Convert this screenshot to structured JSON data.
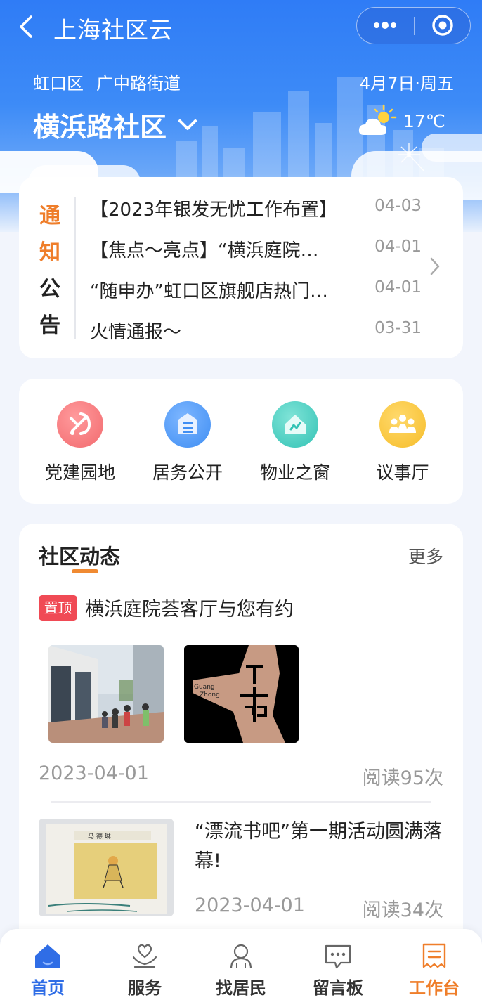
{
  "header": {
    "title": "上海社区云",
    "district": "虹口区",
    "street": "广中路街道",
    "date": "4月7日·周五",
    "community": "横浜路社区",
    "temperature": "17℃"
  },
  "notice": {
    "label_chars": [
      "通",
      "知",
      "公",
      "告"
    ],
    "items": [
      {
        "title": "【2023年银发无忧工作布置】",
        "date": "04-03"
      },
      {
        "title": "【焦点～亮点】“横浜庭院…",
        "date": "04-01"
      },
      {
        "title": "“随申办”虹口区旗舰店热门…",
        "date": "04-01"
      },
      {
        "title": "火情通报～",
        "date": "03-31"
      }
    ]
  },
  "shortcuts": [
    {
      "label": "党建园地",
      "icon": "party-emblem-icon",
      "color": "#f26a6e"
    },
    {
      "label": "居务公开",
      "icon": "notice-board-icon",
      "color": "#3f8ef3"
    },
    {
      "label": "物业之窗",
      "icon": "property-house-icon",
      "color": "#33c3b5"
    },
    {
      "label": "议事厅",
      "icon": "meeting-people-icon",
      "color": "#f6bd2a"
    }
  ],
  "news": {
    "title": "社区动态",
    "more": "更多",
    "pinned": {
      "badge": "置顶",
      "title": "横浜庭院荟客厅与您有约",
      "date": "2023-04-01",
      "reads": "阅读95次",
      "logo_text": [
        "Guang",
        "Zhong"
      ]
    },
    "second": {
      "title": "“漂流书吧”第一期活动圆满落幕!",
      "date": "2023-04-01",
      "reads": "阅读34次",
      "book_text": "马 德 琳"
    }
  },
  "tabbar": [
    {
      "label": "首页",
      "icon": "home-icon",
      "state": "active"
    },
    {
      "label": "服务",
      "icon": "heart-hand-icon",
      "state": "normal"
    },
    {
      "label": "找居民",
      "icon": "residents-icon",
      "state": "normal"
    },
    {
      "label": "留言板",
      "icon": "message-board-icon",
      "state": "normal"
    },
    {
      "label": "工作台",
      "icon": "workbench-icon",
      "state": "work"
    }
  ],
  "colors": {
    "primary": "#2f6de6",
    "accent_orange": "#ef7e2a",
    "badge_red": "#f04a55"
  }
}
